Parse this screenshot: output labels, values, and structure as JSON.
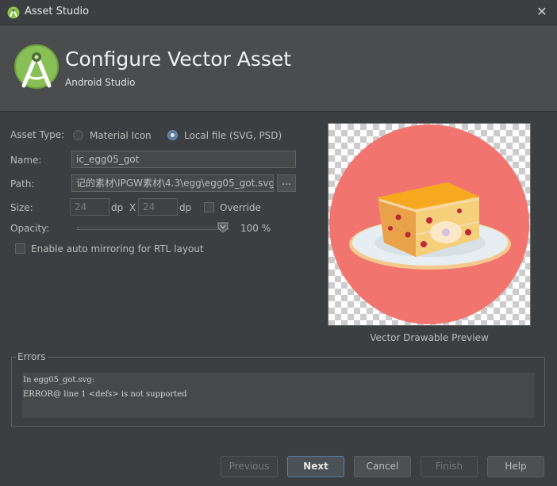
{
  "window": {
    "title": "Asset Studio",
    "app_icon": "android-studio-icon",
    "close_icon": "close-icon"
  },
  "header": {
    "title": "Configure Vector Asset",
    "subtitle": "Android Studio",
    "logo": "android-studio-logo"
  },
  "form": {
    "asset_type_label": "Asset Type:",
    "option_material": "Material Icon",
    "option_local": "Local file (SVG, PSD)",
    "selected_option": "Local file (SVG, PSD)",
    "name_label": "Name:",
    "name_value": "ic_egg05_got",
    "path_label": "Path:",
    "path_value": "记的素材\\IPGW素材\\4.3\\egg\\egg05_got.svg",
    "browse_label": "...",
    "size_label": "Size:",
    "width_value": "24",
    "height_value": "24",
    "unit": "dp",
    "times": "X",
    "override_label": "Override",
    "opacity_label": "Opacity:",
    "opacity_percent": 100,
    "opacity_text": "100 %",
    "rtl_label": "Enable auto mirroring for RTL layout"
  },
  "preview": {
    "caption": "Vector Drawable Preview",
    "circle_color": "#f1756e",
    "plate_color": "#e6eef2"
  },
  "errors": {
    "title": "Errors",
    "lines": [
      "In egg05_got.svg:",
      "ERROR@ line 1 <defs> is not supported"
    ]
  },
  "buttons": {
    "previous": "Previous",
    "next": "Next",
    "cancel": "Cancel",
    "finish": "Finish",
    "help": "Help"
  }
}
